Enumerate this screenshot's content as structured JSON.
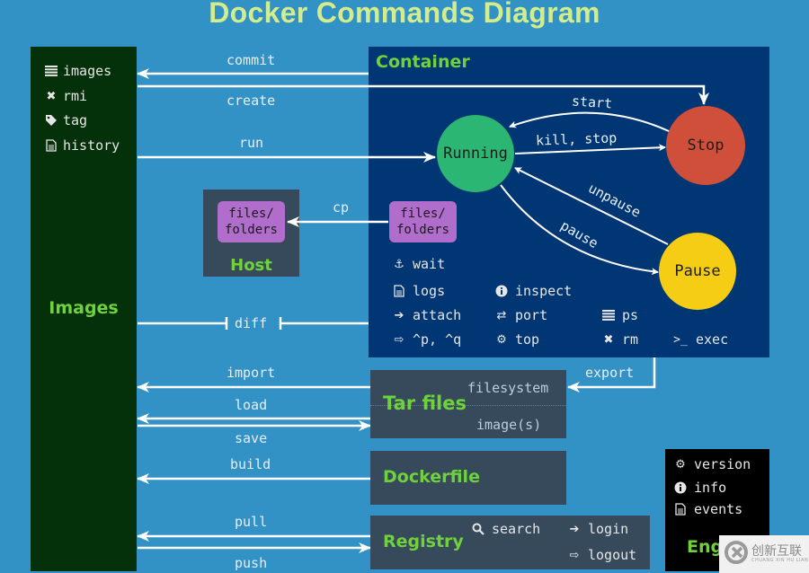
{
  "title": "Docker Commands Diagram",
  "images_panel": {
    "title": "Images",
    "items": [
      {
        "icon": "list-icon",
        "label": "images"
      },
      {
        "icon": "x-icon",
        "label": "rmi"
      },
      {
        "icon": "tag-icon",
        "label": "tag"
      },
      {
        "icon": "document-icon",
        "label": "history"
      }
    ]
  },
  "container_panel": {
    "title": "Container",
    "states": {
      "running": {
        "label": "Running",
        "color": "#2bb673"
      },
      "stop": {
        "label": "Stop",
        "color": "#cf4f3a"
      },
      "pause": {
        "label": "Pause",
        "color": "#f5cd14"
      }
    },
    "transitions": {
      "start": "start",
      "kill_stop": "kill, stop",
      "unpause": "unpause",
      "pause": "pause"
    },
    "files_label": [
      "files/",
      "folders"
    ],
    "commands": [
      {
        "icon": "anchor-icon",
        "label": "wait"
      },
      {
        "icon": "document-icon",
        "label": "logs"
      },
      {
        "icon": "info-icon",
        "label": "inspect"
      },
      {
        "icon": "sign-in-icon",
        "label": "attach"
      },
      {
        "icon": "exchange-icon",
        "label": "port"
      },
      {
        "icon": "list-icon",
        "label": "ps"
      },
      {
        "icon": "sign-out-icon",
        "label": "^p, ^q"
      },
      {
        "icon": "gears-icon",
        "label": "top"
      },
      {
        "icon": "x-icon",
        "label": "rm"
      },
      {
        "icon": "terminal-icon",
        "label": "exec"
      }
    ]
  },
  "host_panel": {
    "title": "Host",
    "files_label": [
      "files/",
      "folders"
    ]
  },
  "arrows": {
    "commit": "commit",
    "create": "create",
    "run": "run",
    "cp": "cp",
    "diff": "diff",
    "import": "import",
    "export": "export",
    "load": "load",
    "save": "save",
    "build": "build",
    "pull": "pull",
    "push": "push"
  },
  "tar_panel": {
    "title": "Tar files",
    "filesystem": "filesystem",
    "images": "image(s)"
  },
  "dockerfile_panel": {
    "title": "Dockerfile"
  },
  "registry_panel": {
    "title": "Registry",
    "items": [
      {
        "icon": "search-icon",
        "label": "search"
      },
      {
        "icon": "sign-in-icon",
        "label": "login"
      },
      {
        "icon": "sign-out-icon",
        "label": "logout"
      }
    ]
  },
  "engine_panel": {
    "title": "Engine",
    "visible_title": "Eng",
    "items": [
      {
        "icon": "gear-icon",
        "label": "version"
      },
      {
        "icon": "info-icon",
        "label": "info"
      },
      {
        "icon": "document-icon",
        "label": "events"
      }
    ]
  },
  "watermark": {
    "text": "创新互联",
    "subtext": "CHUANG XIN HU LIAN"
  },
  "colors": {
    "background": "#3291c5",
    "title": "#d3ec8c",
    "images_panel": "#05310a",
    "container_panel": "#003673",
    "gray_panel": "#364a5c",
    "section_title": "#6fd13b",
    "files_box": "#b06dcb",
    "engine_panel": "#000000"
  }
}
